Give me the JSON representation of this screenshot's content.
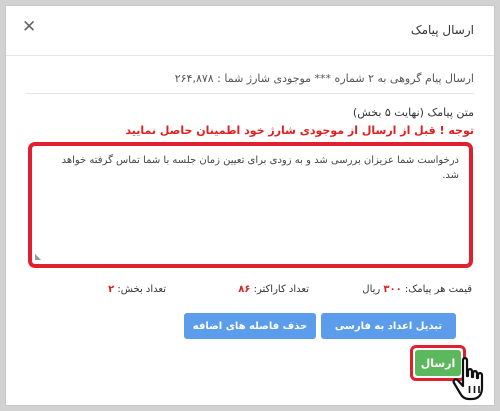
{
  "dialog": {
    "title": "ارسال پیامک",
    "close_symbol": "✕"
  },
  "info_line": "ارسال پیام گروهی به ۲ شماره *** موجودی شارژ شما : ۲۶۴,۸۷۸",
  "message": {
    "label": "متن پیامک (نهایت ۵ بخش)",
    "warning": "توجه ! قبل از ارسال از موجودی شارژ خود اطمینان حاصل نمایید",
    "text": "درخواست شما عزیزان بررسی شد و به زودی برای تعیین زمان جلسه با شما تماس گرفته خواهد شد."
  },
  "stats": {
    "price_label": "قیمت هر پیامک:",
    "price_value": "۳۰۰",
    "price_unit": "ریال",
    "chars_label": "تعداد کاراکتر:",
    "chars_value": "۸۶",
    "parts_label": "تعداد بخش:",
    "parts_value": "۲"
  },
  "buttons": {
    "convert_digits": "تبدیل اعداد به فارسی",
    "remove_spaces": "حذف فاصله های اضافه",
    "send": "ارسال"
  },
  "colors": {
    "highlight": "#e0202e",
    "blue_button": "#5b9dea",
    "green_button": "#5cb85c",
    "warning_text": "#e02020"
  },
  "icons": {
    "close": "close-icon",
    "cursor": "hand-pointer-icon",
    "resize": "resize-grip-icon"
  }
}
